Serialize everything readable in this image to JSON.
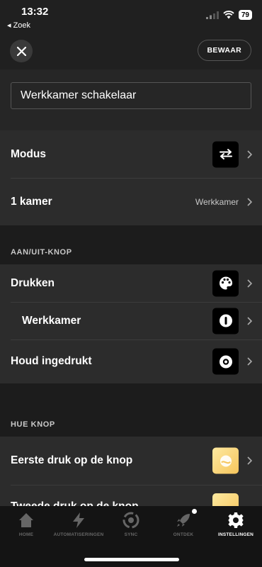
{
  "status": {
    "time": "13:32",
    "back_app": "◂ Zoek",
    "battery": "79"
  },
  "header": {
    "save_label": "BEWAAR"
  },
  "name_field": {
    "value": "Werkkamer schakelaar"
  },
  "group1": {
    "mode_label": "Modus",
    "room_label": "1 kamer",
    "room_value": "Werkkamer"
  },
  "onoff_section": {
    "title": "AAN/UIT-KNOP",
    "press_label": "Drukken",
    "room_label": "Werkkamer",
    "hold_label": "Houd ingedrukt"
  },
  "hue_section": {
    "title": "HUE KNOP",
    "first_label": "Eerste druk op de knop",
    "second_label": "Tweede druk op de knop"
  },
  "tabs": [
    {
      "label": "HOME",
      "icon": "home-icon"
    },
    {
      "label": "AUTOMATISERINGEN",
      "icon": "bolt-icon"
    },
    {
      "label": "SYNC",
      "icon": "sync-icon"
    },
    {
      "label": "ONTDEK",
      "icon": "rocket-icon"
    },
    {
      "label": "INSTELLINGEN",
      "icon": "gear-icon",
      "active": true
    }
  ],
  "colors": {
    "background": "#1c1c1c",
    "row": "#2c2c2c",
    "accent_yellow": "#f6c55c"
  }
}
